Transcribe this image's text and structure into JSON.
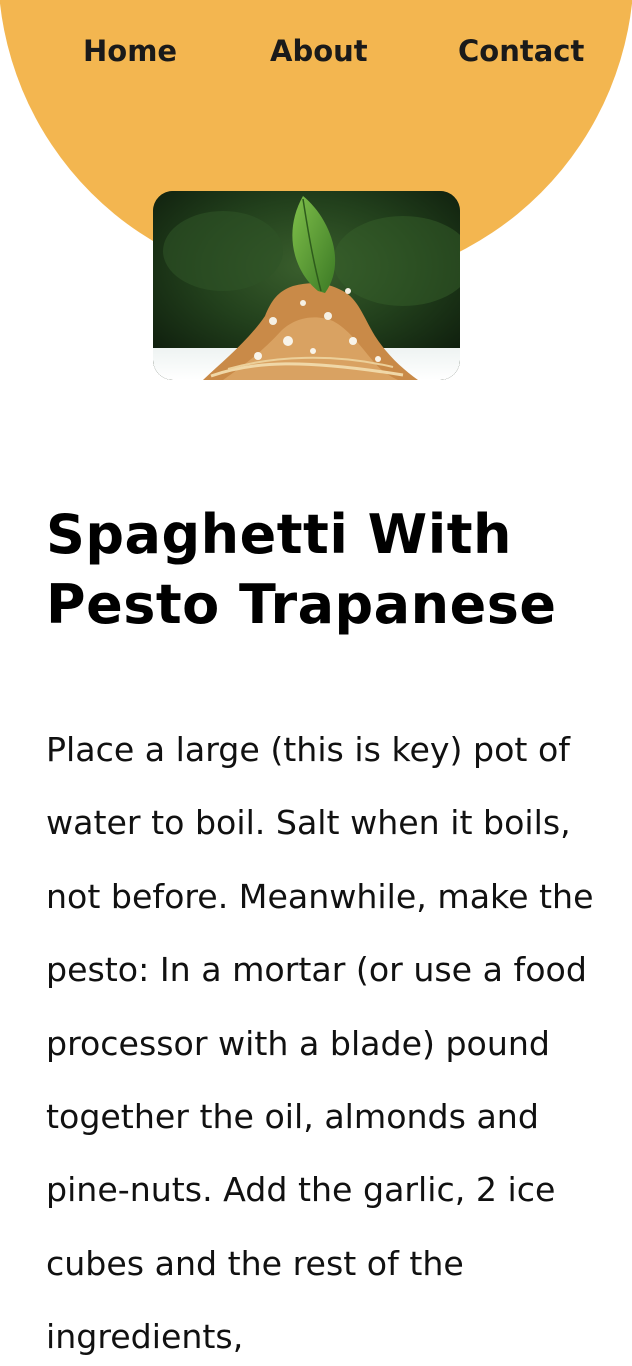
{
  "nav": {
    "items": [
      {
        "label": "Home"
      },
      {
        "label": "About"
      },
      {
        "label": "Contact"
      }
    ]
  },
  "hero": {
    "image_icon": "spaghetti-pesto-photo"
  },
  "recipe": {
    "title": "Spaghetti With Pesto Trapanese",
    "description": "Place a large (this is key) pot of water to boil. Salt when it boils, not before. Meanwhile, make the pesto: In a mortar (or use a food processor with a blade) pound together the oil, almonds and pine-nuts. Add the garlic, 2 ice cubes and the rest of the ingredients,"
  },
  "colors": {
    "accent": "#f3b650",
    "text": "#000000",
    "background": "#ffffff"
  }
}
